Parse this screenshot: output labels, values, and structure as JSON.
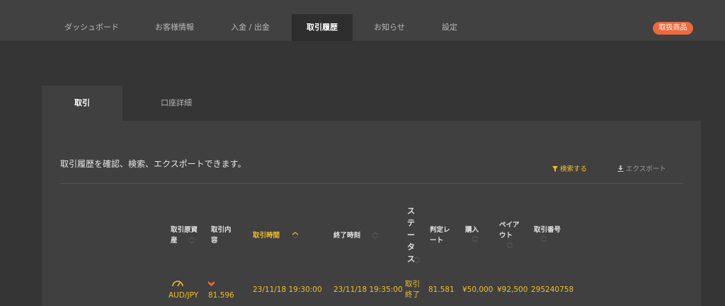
{
  "nav": {
    "items": [
      {
        "label": "ダッシュボード",
        "active": false
      },
      {
        "label": "お客様情報",
        "active": false
      },
      {
        "label": "入金 / 出金",
        "active": false
      },
      {
        "label": "取引履歴",
        "active": true
      },
      {
        "label": "お知らせ",
        "active": false
      },
      {
        "label": "設定",
        "active": false
      }
    ],
    "products_button": "取扱商品"
  },
  "tabs": [
    {
      "label": "取引",
      "active": true
    },
    {
      "label": "口座詳細",
      "active": false
    }
  ],
  "main": {
    "description": "取引履歴を確認、検索、エクスポートできます。",
    "search_label": "検索する",
    "export_label": "エクスポート"
  },
  "table": {
    "headers": {
      "asset": "取引原資産",
      "content": "取引内容",
      "trade_time": "取引時間",
      "end_time": "終了時刻",
      "status": "ステータス",
      "rate": "判定レート",
      "buy": "購入",
      "payout": "ペイアウト",
      "number": "取引番号"
    },
    "rows": [
      {
        "asset": "AUD/JPY",
        "direction": "down",
        "content": "81.596",
        "trade_time": "23/11/18 19:30:00",
        "end_time": "23/11/18 19:35:00",
        "status": "取引終了",
        "rate": "81.581",
        "buy": "¥50,000",
        "payout": "¥92,500",
        "number": "295240758"
      }
    ]
  },
  "colors": {
    "accent": "#f2be28",
    "pill": "#ec6a3c"
  }
}
